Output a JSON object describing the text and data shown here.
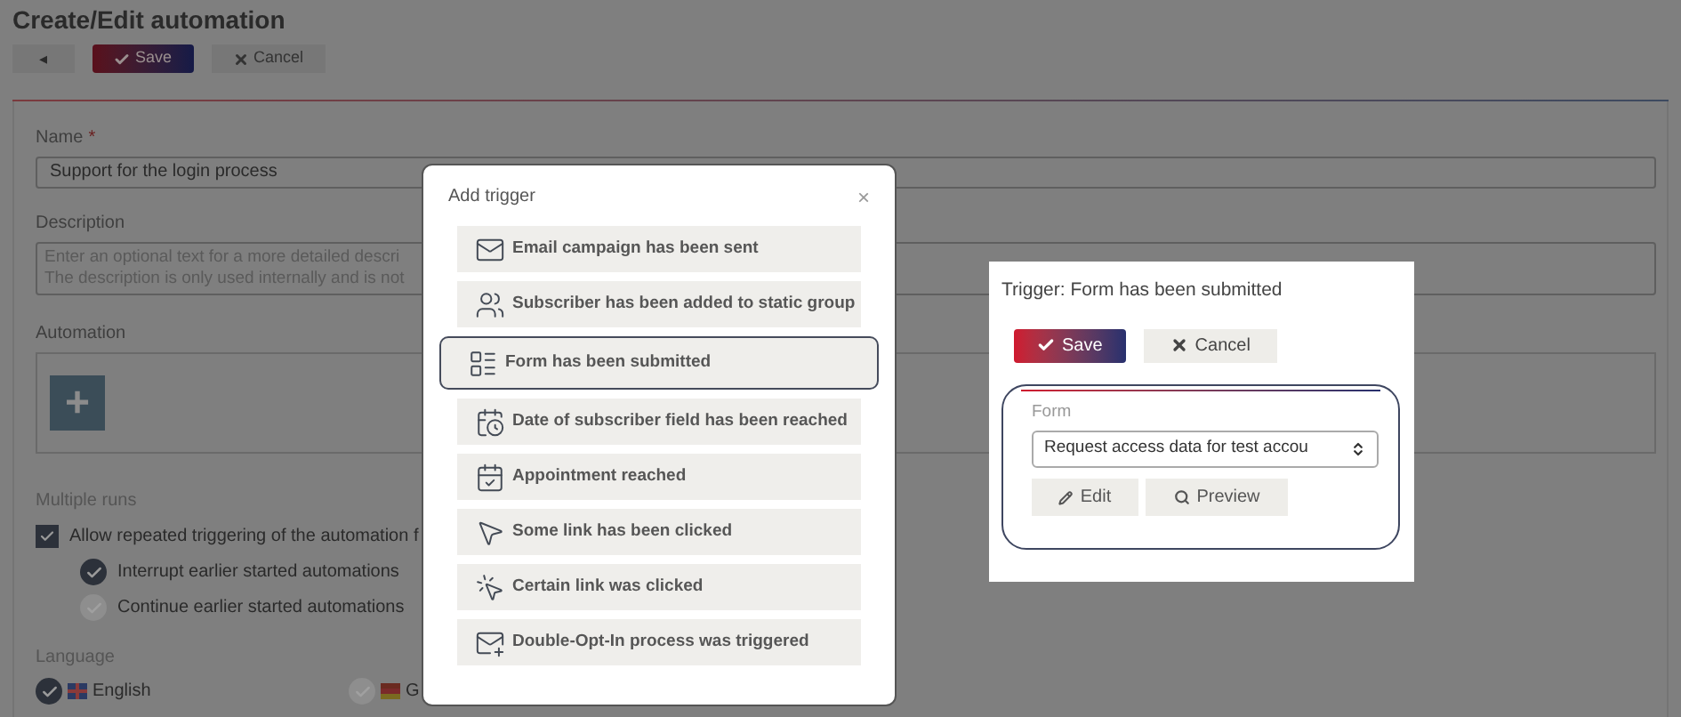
{
  "page": {
    "title": "Create/Edit automation",
    "toolbar": {
      "back": "◂",
      "save": "Save",
      "cancel": "Cancel"
    },
    "name": {
      "label": "Name",
      "required_mark": "*",
      "value": "Support for the login process"
    },
    "description": {
      "label": "Description",
      "placeholder_lines": [
        "Enter an optional text for a more detailed descri",
        "The description is only used internally and is not"
      ]
    },
    "automation": {
      "label": "Automation",
      "add": "+"
    },
    "multiple_runs": {
      "label": "Multiple runs",
      "allow": {
        "label": "Allow repeated triggering of the automation f",
        "checked": true
      },
      "options": [
        {
          "label": "Interrupt earlier started automations",
          "selected": true
        },
        {
          "label": "Continue earlier started automations",
          "selected": false
        }
      ]
    },
    "language": {
      "label": "Language",
      "options": [
        {
          "label": "English",
          "kind": "uk",
          "selected": true
        },
        {
          "label": "G",
          "kind": "de",
          "selected": false
        }
      ]
    }
  },
  "add_trigger": {
    "title": "Add trigger",
    "close": "×",
    "items": [
      {
        "kind": "email",
        "label": "Email campaign has been sent",
        "selected": false
      },
      {
        "kind": "group",
        "label": "Subscriber has been added to static group",
        "selected": false
      },
      {
        "kind": "form",
        "label": "Form has been submitted",
        "selected": true
      },
      {
        "kind": "date",
        "label": "Date of subscriber field has been reached",
        "selected": false
      },
      {
        "kind": "appointment",
        "label": "Appointment reached",
        "selected": false
      },
      {
        "kind": "click",
        "label": "Some link has been clicked",
        "selected": false
      },
      {
        "kind": "link",
        "label": "Certain link was clicked",
        "selected": false
      },
      {
        "kind": "doi",
        "label": "Double-Opt-In process was triggered",
        "selected": false
      }
    ]
  },
  "trigger_panel": {
    "title": "Trigger: Form has been submitted",
    "save": "Save",
    "cancel": "Cancel",
    "form": {
      "label": "Form",
      "value": "Request access data for test accou",
      "edit": "Edit",
      "preview": "Preview"
    }
  }
}
